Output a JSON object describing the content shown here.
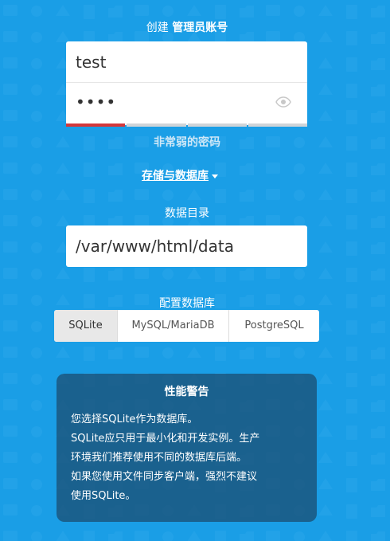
{
  "colors": {
    "background": "#1a9ee6",
    "strength_bar": "#d3373a",
    "warning_bg": "#1f5f8c"
  },
  "admin": {
    "title_prefix": "创建",
    "title_strong": "管理员账号",
    "username_value": "test",
    "password_mask": "••••",
    "eye_icon": "eye-icon",
    "strength_fraction": 0.25,
    "strength_text": "非常弱的密码"
  },
  "storage": {
    "toggle_label": "存储与数据库",
    "data_dir_label": "数据目录",
    "data_dir_value": "/var/www/html/data",
    "db_label": "配置数据库",
    "db_options": [
      "SQLite",
      "MySQL/MariaDB",
      "PostgreSQL"
    ],
    "db_selected": "SQLite"
  },
  "warning": {
    "title": "性能警告",
    "lines": [
      "您选择SQLite作为数据库。",
      "SQLite应只用于最小化和开发实例。生产",
      "环境我们推荐使用不同的数据库后端。",
      "如果您使用文件同步客户端，强烈不建议",
      "使用SQLite。"
    ]
  }
}
